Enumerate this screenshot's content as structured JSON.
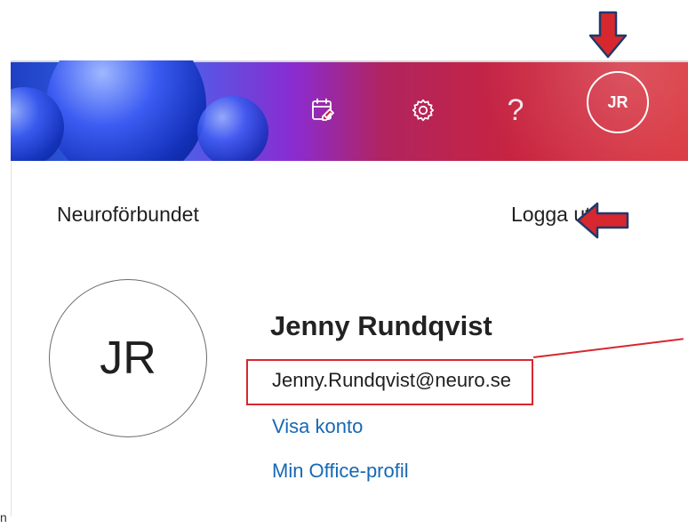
{
  "topbar": {
    "icons": [
      "calendar-check-icon",
      "gear-icon",
      "help-icon"
    ],
    "help_glyph": "?",
    "avatar_initials": "JR"
  },
  "account": {
    "organization": "Neuroförbundet",
    "logout_label": "Logga ut",
    "avatar_initials": "JR",
    "name": "Jenny Rundqvist",
    "email": "Jenny.Rundqvist@neuro.se",
    "view_account_label": "Visa konto",
    "office_profile_label": "Min Office-profil"
  },
  "left_stub": "n",
  "colors": {
    "annotation_red": "#d7272f",
    "link_blue": "#1768b5",
    "avatar_border": "#6b6b6b"
  }
}
